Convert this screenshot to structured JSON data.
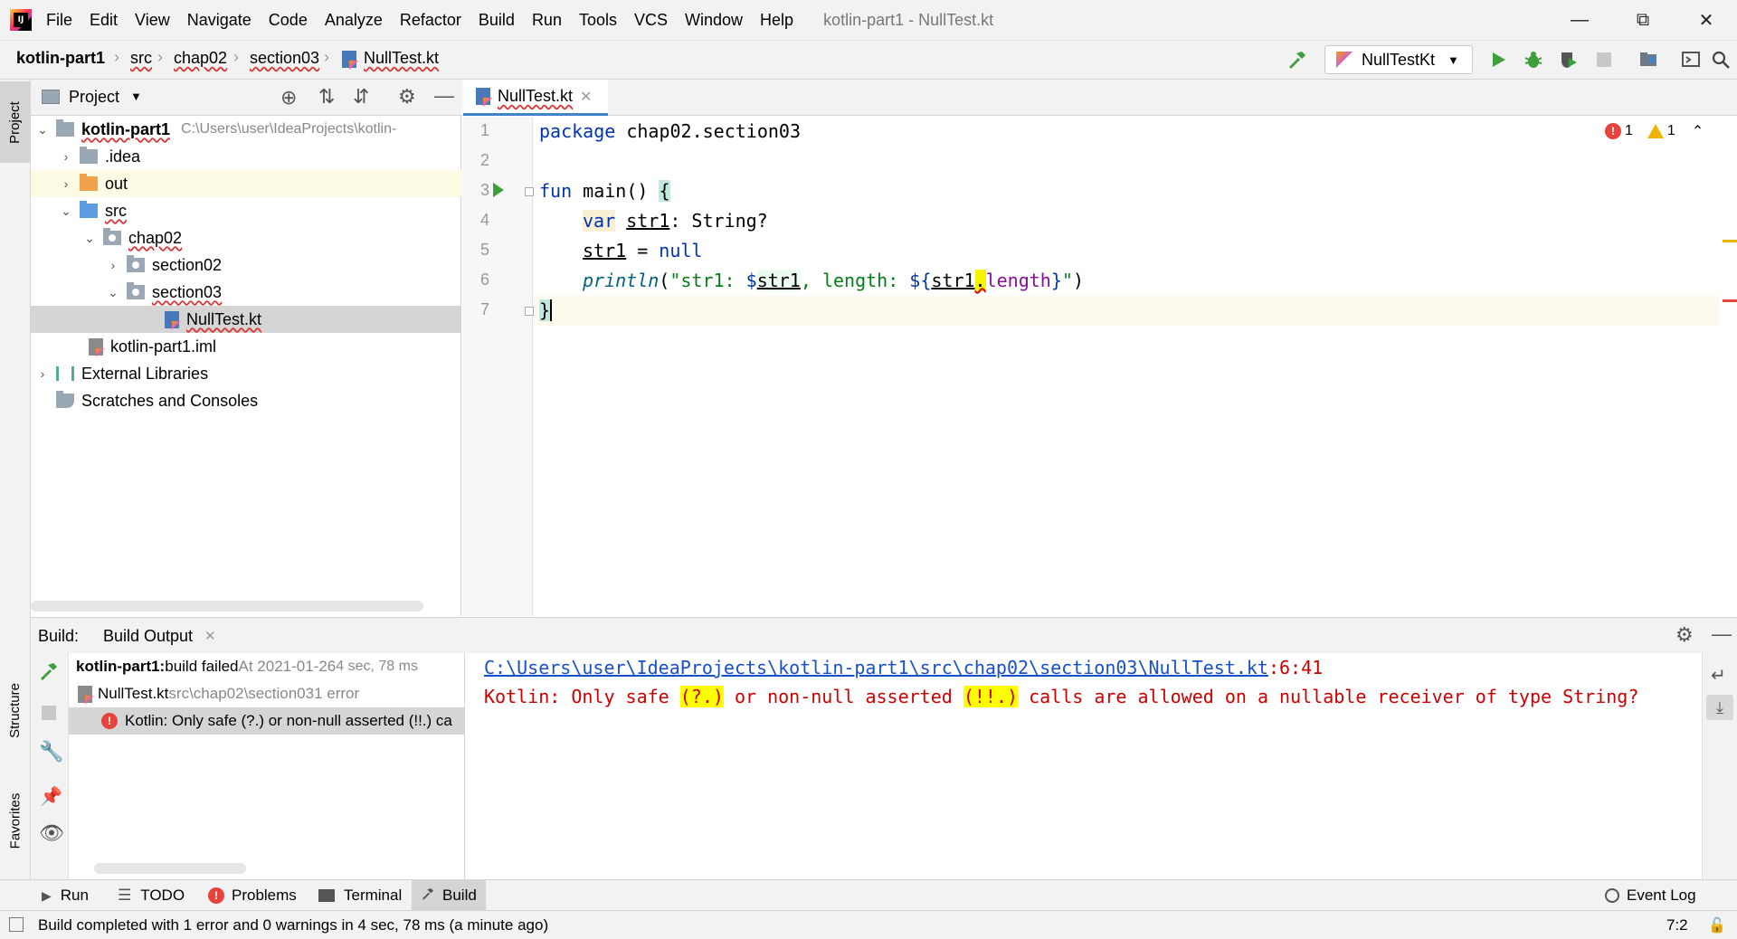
{
  "menubar": {
    "items": [
      {
        "label": "File"
      },
      {
        "label": "Edit"
      },
      {
        "label": "View"
      },
      {
        "label": "Navigate"
      },
      {
        "label": "Code"
      },
      {
        "label": "Analyze"
      },
      {
        "label": "Refactor"
      },
      {
        "label": "Build"
      },
      {
        "label": "Run"
      },
      {
        "label": "Tools"
      },
      {
        "label": "VCS"
      },
      {
        "label": "Window"
      },
      {
        "label": "Help"
      }
    ],
    "window_title": "kotlin-part1 - NullTest.kt"
  },
  "breadcrumb": {
    "items": [
      "kotlin-part1",
      "src",
      "chap02",
      "section03",
      "NullTest.kt"
    ]
  },
  "toolbar": {
    "run_config": "NullTestKt"
  },
  "sidebar": {
    "project_tab": "Project",
    "structure_tab": "Structure",
    "favorites_tab": "Favorites"
  },
  "project": {
    "header_label": "Project",
    "tree": [
      {
        "label": "kotlin-part1",
        "hint": "C:\\Users\\user\\IdeaProjects\\kotlin-"
      },
      {
        "label": ".idea"
      },
      {
        "label": "out"
      },
      {
        "label": "src"
      },
      {
        "label": "chap02"
      },
      {
        "label": "section02"
      },
      {
        "label": "section03"
      },
      {
        "label": "NullTest.kt"
      },
      {
        "label": "kotlin-part1.iml"
      },
      {
        "label": "External Libraries"
      },
      {
        "label": "Scratches and Consoles"
      }
    ]
  },
  "editor": {
    "tab_label": "NullTest.kt",
    "line_numbers": [
      "1",
      "2",
      "3",
      "4",
      "5",
      "6",
      "7"
    ],
    "code": {
      "l1_kw": "package",
      "l1_rest": " chap02.section03",
      "l3_kw": "fun",
      "l3_rest": " main() ",
      "l3_brace": "{",
      "l4_kw": "var",
      "l4_var": "str1",
      "l4_rest": ": String?",
      "l5_var": "str1",
      "l5_eq": " = ",
      "l5_null": "null",
      "l6_fn": "println",
      "l6_open": "(",
      "l6_str1": "\"str1: ",
      "l6_dollar": "$",
      "l6_v1": "str1",
      "l6_str2": ", length: ",
      "l6_tpl_open": "${",
      "l6_v2": "str1",
      "l6_dot": ".",
      "l6_len": "length",
      "l6_tpl_close": "}",
      "l6_str3": "\"",
      "l6_close": ")",
      "l7_brace": "}"
    },
    "errors_count": "1",
    "warnings_count": "1"
  },
  "build": {
    "header_label": "Build:",
    "tab_label": "Build Output",
    "tree": {
      "root_label": "kotlin-part1:",
      "root_status": " build failed",
      "root_time": " At 2021-01-26",
      "root_duration": " 4 sec, 78 ms",
      "file_label": "NullTest.kt",
      "file_path": " src\\chap02\\section03",
      "file_errors": " 1 error",
      "error_label": "Kotlin: Only safe (?.) or non-null asserted (!!.) ca"
    },
    "output": {
      "link": "C:\\Users\\user\\IdeaProjects\\kotlin-part1\\src\\chap02\\section03\\NullTest.kt",
      "link_pos": ":6:41",
      "msg_a": "Kotlin: Only safe ",
      "msg_b": "(?.)",
      "msg_c": " or non-null asserted ",
      "msg_d": "(!!.)",
      "msg_e": " calls are allowed on a nullable receiver of type String?"
    }
  },
  "tool_tabs": {
    "run": "Run",
    "todo": "TODO",
    "problems": "Problems",
    "terminal": "Terminal",
    "build": "Build",
    "event_log": "Event Log"
  },
  "status": {
    "message": "Build completed with 1 error and 0 warnings in 4 sec, 78 ms (a minute ago)",
    "caret": "7:2"
  },
  "colors": {
    "keyword": "#0033b3",
    "string": "#067d17",
    "error": "#c00000",
    "accent": "#4083c9",
    "run_green": "#3c9f3c"
  }
}
